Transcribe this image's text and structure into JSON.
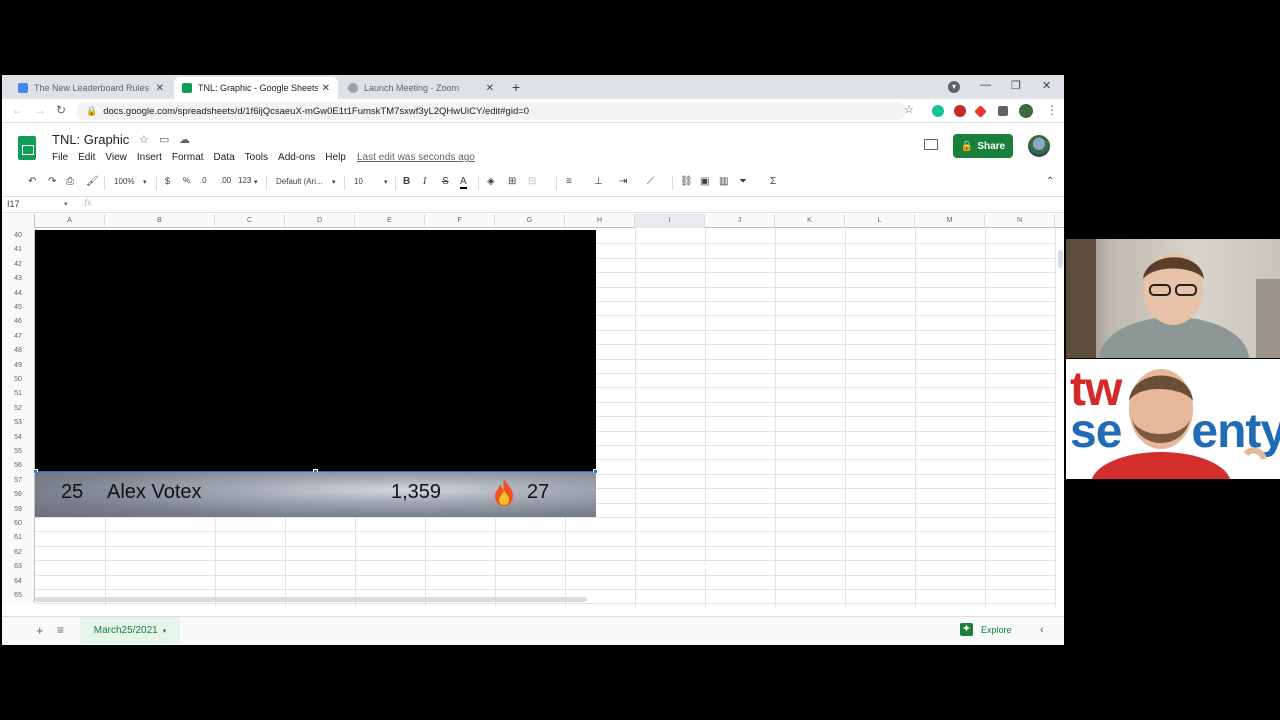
{
  "browser": {
    "tabs": [
      {
        "title": "The New Leaderboard Rules - Go",
        "favicon_color": "#4285f4",
        "active": false
      },
      {
        "title": "TNL: Graphic - Google Sheets",
        "favicon_color": "#0f9d58",
        "active": true
      },
      {
        "title": "Launch Meeting - Zoom",
        "favicon_color": "#9aa0a6",
        "active": false
      }
    ],
    "url": "docs.google.com/spreadsheets/d/1f6ijQcsaeuX-mGw0E1t1FumskTM7sxwf3yL2QHwUiCY/edit#gid=0"
  },
  "sheets": {
    "doc_title": "TNL: Graphic",
    "menu": [
      "File",
      "Edit",
      "View",
      "Insert",
      "Format",
      "Data",
      "Tools",
      "Add-ons",
      "Help"
    ],
    "last_edit": "Last edit was seconds ago",
    "share_label": "Share",
    "toolbar": {
      "zoom": "100%",
      "currency": "$",
      "percent": "%",
      "decimal_less": ".0",
      "decimal_more": ".00",
      "format_more": "123",
      "font": "Default (Ari...",
      "font_size": "10",
      "bold": "B",
      "italic": "I",
      "strike": "S",
      "text_color": "A",
      "sum": "Σ"
    },
    "name_box": "I17",
    "fx_label": "fx",
    "columns": [
      "A",
      "B",
      "C",
      "D",
      "E",
      "F",
      "G",
      "H",
      "I",
      "J",
      "K",
      "L",
      "M",
      "N"
    ],
    "selected_column": "I",
    "rows": [
      "40",
      "41",
      "42",
      "43",
      "44",
      "45",
      "46",
      "47",
      "48",
      "49",
      "50",
      "51",
      "52",
      "53",
      "54",
      "55",
      "56",
      "57",
      "58",
      "59",
      "60",
      "61",
      "62",
      "63",
      "64",
      "65"
    ],
    "graphic": {
      "rank": "25",
      "name": "Alex Votex",
      "score": "1,359",
      "streak": "27",
      "flame_icon": "fire-icon"
    },
    "sheet_tab": "March25/2021",
    "explore_label": "Explore"
  },
  "webcam": {
    "brand_text_line1": "tw",
    "brand_text_line2": "se",
    "brand_text_line2b": "enty",
    "brand_color": "#d62828"
  },
  "colors": {
    "sheets_green": "#188038",
    "selection_blue": "#1a73e8"
  }
}
